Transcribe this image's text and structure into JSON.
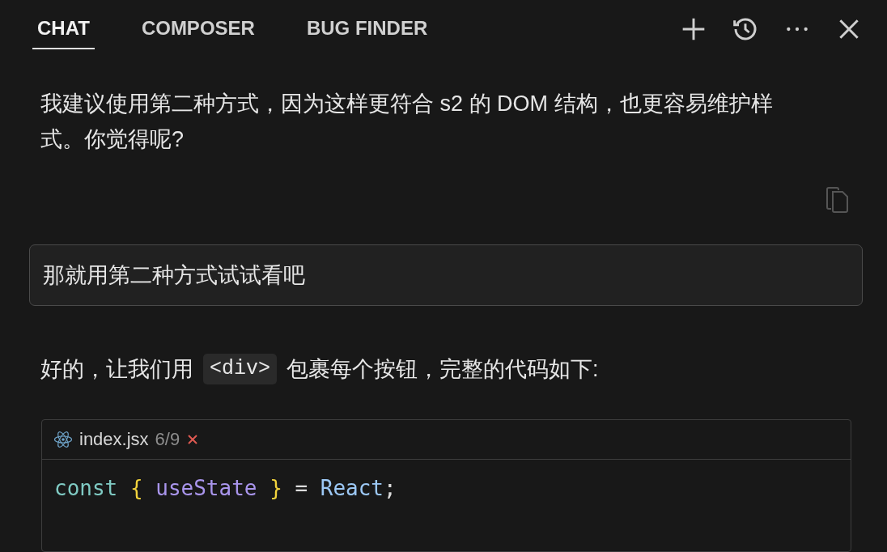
{
  "tabs": [
    {
      "label": "CHAT",
      "selected": true
    },
    {
      "label": "COMPOSER",
      "selected": false
    },
    {
      "label": "BUG FINDER",
      "selected": false
    }
  ],
  "assistant_message": {
    "text": "我建议使用第二种方式，因为这样更符合 s2 的 DOM 结构，也更容易维护样式。你觉得呢?"
  },
  "user_message": {
    "text": "那就用第二种方式试试看吧"
  },
  "reply": {
    "parts": [
      {
        "kind": "text",
        "text": "好的，让我们用"
      },
      {
        "kind": "code",
        "text": "<div>"
      },
      {
        "kind": "text",
        "text": "包裹每个按钮，完整的代码如下:"
      }
    ]
  },
  "code_block": {
    "filename": "index.jsx",
    "position": "6/9",
    "lines": [
      [
        {
          "kind": "keyword",
          "text": "const "
        },
        {
          "kind": "brace",
          "text": "{ "
        },
        {
          "kind": "variable",
          "text": "useState "
        },
        {
          "kind": "brace",
          "text": "} "
        },
        {
          "kind": "operator",
          "text": "= "
        },
        {
          "kind": "class",
          "text": "React"
        },
        {
          "kind": "punct",
          "text": ";"
        }
      ]
    ]
  }
}
